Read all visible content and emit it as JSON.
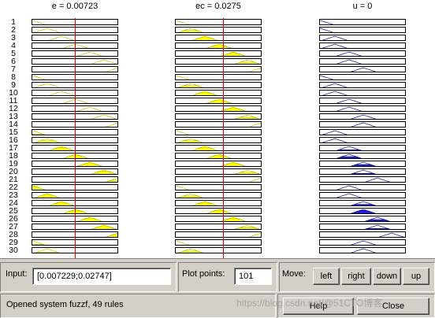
{
  "columns": [
    {
      "title": "e = 0.00723",
      "color": "#ffff00",
      "line_value": 0.00723
    },
    {
      "title": "ec = 0.0275",
      "color": "#ffff00",
      "line_value": 0.0275
    },
    {
      "title": "u = 0",
      "color": "#2020e0",
      "line_value": null
    }
  ],
  "rows": [
    "1",
    "2",
    "3",
    "4",
    "5",
    "6",
    "7",
    "8",
    "9",
    "10",
    "11",
    "12",
    "13",
    "14",
    "15",
    "16",
    "17",
    "18",
    "19",
    "20",
    "21",
    "22",
    "23",
    "24",
    "25",
    "26",
    "27",
    "28",
    "29",
    "30"
  ],
  "e_mf_centers": [
    -3,
    -2,
    -1,
    0,
    1,
    2,
    3,
    -3,
    -2,
    -1,
    0,
    1,
    2,
    3,
    -3,
    -2,
    -1,
    0,
    1,
    2,
    3,
    -3,
    -2,
    -1,
    0,
    1,
    2,
    3,
    -3,
    -2
  ],
  "ec_mf_centers": [
    -3,
    -2,
    -1,
    0,
    1,
    2,
    3,
    -3,
    -2,
    -1,
    0,
    1,
    2,
    3,
    -3,
    -2,
    -1,
    0,
    1,
    2,
    3,
    -3,
    -2,
    -1,
    0,
    1,
    2,
    3,
    -3,
    -2
  ],
  "e_fill_levels": [
    0,
    0,
    0,
    0,
    0,
    0,
    0,
    0,
    0,
    0,
    0,
    0,
    0,
    0,
    0.3,
    0.5,
    0.8,
    1,
    1,
    0.8,
    0.5,
    1,
    1,
    1,
    1,
    1,
    1,
    1,
    0.3,
    0.3
  ],
  "ec_fill_levels": [
    0,
    0.5,
    1,
    1,
    1,
    0.5,
    0,
    0,
    0.5,
    1,
    1,
    1,
    0.5,
    0,
    0,
    0.5,
    1,
    1,
    1,
    0.5,
    0,
    0,
    0.5,
    1,
    1,
    1,
    0.5,
    0,
    0,
    0.5
  ],
  "u_mf_centers": [
    -3,
    -3,
    -2,
    -2,
    -1,
    -1,
    0,
    -3,
    -2,
    -2,
    -1,
    -1,
    0,
    0,
    -2,
    -2,
    -1,
    -1,
    0,
    0,
    1,
    -1,
    -1,
    0,
    0,
    1,
    1,
    2,
    0,
    0
  ],
  "u_fill_levels": [
    0,
    0,
    0,
    0,
    0,
    0,
    0,
    0,
    0,
    0,
    0,
    0,
    0,
    0,
    0,
    0,
    0.3,
    0.5,
    0.5,
    0.3,
    0,
    0,
    0,
    0.4,
    0.8,
    0.5,
    0.3,
    0,
    0,
    0
  ],
  "input": {
    "label": "Input:",
    "value": "[0.007229;0.02747]"
  },
  "plot_points": {
    "label": "Plot points:",
    "value": "101"
  },
  "move": {
    "label": "Move:",
    "left": "left",
    "right": "right",
    "down": "down",
    "up": "up"
  },
  "buttons": {
    "help": "Help",
    "close": "Close"
  },
  "status": "Opened system fuzzf, 49 rules",
  "watermark": "https://blog.csdn.net/@51CTO博客"
}
